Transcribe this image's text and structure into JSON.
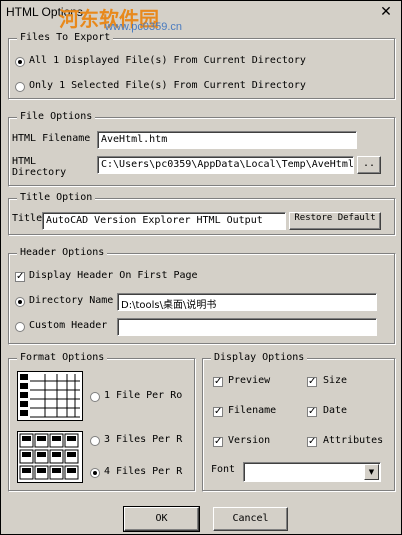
{
  "window": {
    "title": "HTML Options",
    "close_glyph": "✕"
  },
  "watermark": {
    "text": "河东软件园",
    "url": "www.pc0359.cn"
  },
  "files_to_export": {
    "legend": "Files To Export",
    "option_all": "All 1 Displayed File(s) From Current Directory",
    "option_selected": "Only 1 Selected File(s) From Current Directory",
    "selected": "all"
  },
  "file_options": {
    "legend": "File Options",
    "filename_label": "HTML Filename",
    "filename_value": "AveHtml.htm",
    "directory_label": "HTML Directory",
    "directory_value": "C:\\Users\\pc0359\\AppData\\Local\\Temp\\AveHtml",
    "browse_label": ".."
  },
  "title_option": {
    "legend": "Title Option",
    "title_label": "Title",
    "title_value": "AutoCAD Version Explorer HTML Output",
    "restore_label": "Restore Default"
  },
  "header_options": {
    "legend": "Header Options",
    "display_header_label": "Display Header On First Page",
    "display_header_checked": true,
    "directory_name_label": "Directory Name",
    "directory_name_value": "D:\\tools\\桌面\\说明书",
    "custom_header_label": "Custom Header",
    "custom_header_value": "",
    "selected": "directory_name"
  },
  "format_options": {
    "legend": "Format Options",
    "option_1": "1 File Per Ro",
    "option_3": "3 Files Per R",
    "option_4": "4 Files Per R",
    "selected": "4"
  },
  "display_options": {
    "legend": "Display Options",
    "preview_label": "Preview",
    "size_label": "Size",
    "filename_label": "Filename",
    "date_label": "Date",
    "version_label": "Version",
    "attributes_label": "Attributes",
    "font_label": "Font",
    "font_value": ""
  },
  "buttons": {
    "ok": "OK",
    "cancel": "Cancel"
  }
}
